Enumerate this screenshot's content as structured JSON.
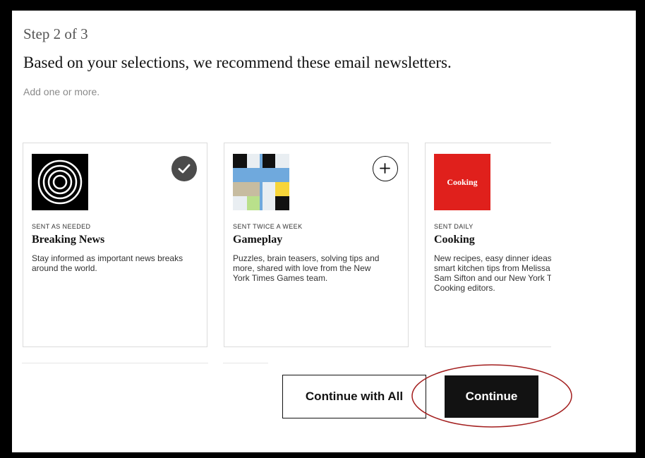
{
  "header": {
    "step": "Step 2 of 3",
    "headline": "Based on your selections, we recommend these email newsletters.",
    "subtext": "Add one or more."
  },
  "newsletters": [
    {
      "frequency": "SENT AS NEEDED",
      "title": "Breaking News",
      "description": "Stay informed as important news breaks around the world.",
      "selected": true,
      "icon": "concentric-circles-logo"
    },
    {
      "frequency": "SENT TWICE A WEEK",
      "title": "Gameplay",
      "description": "Puzzles, brain teasers, solving tips and more, shared with love from the New York Times Games team.",
      "selected": false,
      "icon": "crossword-grid-logo"
    },
    {
      "frequency": "SENT DAILY",
      "title": "Cooking",
      "description": "New recipes, easy dinner ideas and smart kitchen tips from Melissa Clark, Sam Sifton and our New York Times Cooking editors.",
      "selected": false,
      "icon": "cooking-logo",
      "logo_text": "Cooking"
    }
  ],
  "buttons": {
    "continue_all": "Continue with All",
    "continue": "Continue"
  },
  "colors": {
    "accent": "#121212",
    "selected_badge": "#4b4b4b",
    "cooking_red": "#e0201c",
    "annotation": "#a31e1e"
  }
}
